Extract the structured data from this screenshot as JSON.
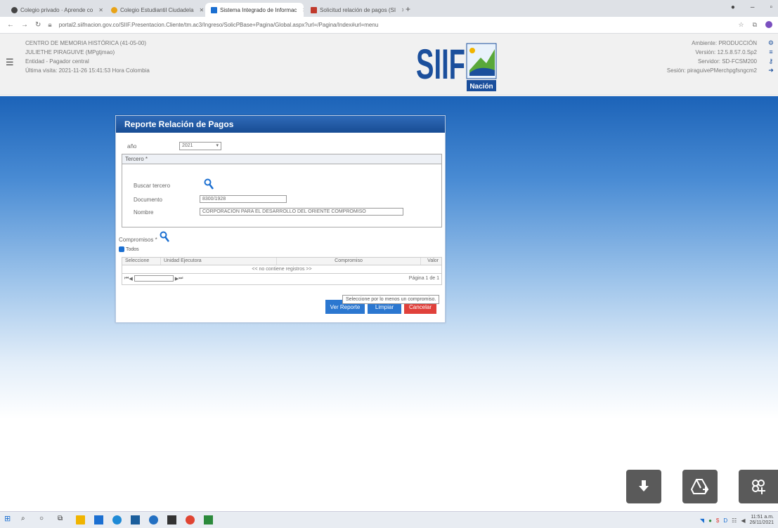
{
  "browser": {
    "tabs": [
      {
        "label": "Colegio privado · Aprende co",
        "color": "#444444"
      },
      {
        "label": "Colegio Estudiantil Ciudadela",
        "color": "#e8a317"
      },
      {
        "label": "Sistema Integrado de Informac",
        "color": "#1b6fd1"
      },
      {
        "label": "Solicitud relación de pagos (SI",
        "color": "#c0392b"
      }
    ],
    "url": "portal2.siifnacion.gov.co/SIIF.Presentacion.Cliente/tm.ac3/Ingreso/SolicPBase+Pagina/Global.aspx?url=/Pagina/Index#url=menu",
    "icons": [
      "star-icon",
      "extensions-icon",
      "profile-icon"
    ]
  },
  "header": {
    "user_lines": [
      "CENTRO DE MEMORIA HISTÓRICA (41-05-00)",
      "JULIETHE PIRAGUIVE (MPgtjmao)",
      "Entidad - Pagador central",
      "Última visita: 2021-11-26 15:41:53 Hora Colombia"
    ],
    "system_lines": [
      "Ambiente: PRODUCCIÓN",
      "Versión: 12.5.8.57.0.Sp2",
      "Servidor: SD-FCSM200",
      "Sesión: piraguivePMerchpgfsngcm2"
    ],
    "logo_text": "SIIF",
    "logo_sub": "Nación"
  },
  "dialog": {
    "title": "Reporte Relación de Pagos",
    "year_label": "año",
    "year_value": "2021",
    "tercero_label": "Tercero *",
    "buscar_label": "Buscar tercero",
    "documento_label": "Documento",
    "documento_value": "8300/1928",
    "nombre_label": "Nombre",
    "nombre_value": "CORPORACION PARA EL DESARROLLO DEL ORIENTE COMPROMISO",
    "compromisos_label": "Compromisos *",
    "todos_label": "Todos",
    "grid_headers": [
      "Seleccione",
      "Unidad Ejecutora",
      "Compromiso",
      "Valor"
    ],
    "grid_empty": "<< no contiene registros >>",
    "pager_text": "Página 1 de 1",
    "tooltip": "Seleccione por lo menos un compromiso.",
    "buttons": [
      "Ver Reporte",
      "Limpiar",
      "Cancelar"
    ]
  },
  "colors": {
    "accent": "#1c63b8",
    "button_blue": "#2b77d0",
    "button_red": "#e0413b",
    "fab": "#5a5a5a"
  },
  "fabs": [
    "download-icon",
    "add-drive-icon",
    "add-option-icon"
  ],
  "clock": {
    "time": "11:51 a.m.",
    "date": "26/11/2021"
  }
}
